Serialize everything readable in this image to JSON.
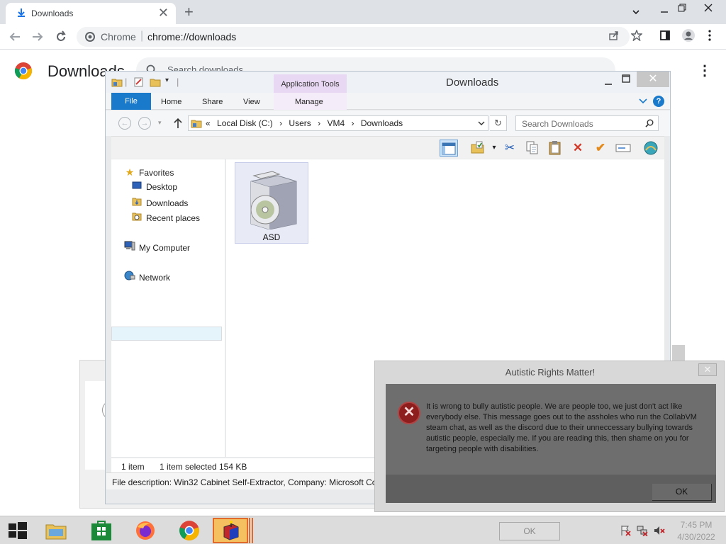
{
  "chrome": {
    "tab_title": "Downloads",
    "tab_close": "✕",
    "new_tab": "+",
    "site_label": "Chrome",
    "url": "chrome://downloads",
    "page_title": "Downloads",
    "search_placeholder": "Search downloads"
  },
  "explorer": {
    "title": "Downloads",
    "app_tools_label": "Application Tools",
    "ribbon_tabs": [
      "File",
      "Home",
      "Share",
      "View",
      "Manage"
    ],
    "breadcrumb": [
      "«",
      "Local Disk (C:)",
      "›",
      "Users",
      "›",
      "VM4",
      "›",
      "Downloads"
    ],
    "search_placeholder": "Search Downloads",
    "nav": {
      "favorites": "Favorites",
      "desktop": "Desktop",
      "downloads": "Downloads",
      "recent": "Recent places",
      "computer": "My Computer",
      "network": "Network"
    },
    "file_name": "ASD",
    "status": {
      "count": "1 item",
      "selected": "1 item selected",
      "size": "154 KB"
    },
    "description": "File description: Win32 Cabinet Self-Extractor, Company: Microsoft Co"
  },
  "dialog": {
    "title": "Autistic Rights Matter!",
    "message": "It is wrong to bully autistic people. We are people too, we just don't act like everybody else. This message goes out to the assholes who run the CollabVM steam chat, as well as the discord due to their unneccessary bullying towards autistic people, especially me. If you are reading this, then shame on you for targeting people with disabilities.",
    "ok_label": "OK"
  },
  "taskbar": {
    "ghost_ok_label": "OK",
    "time": "7:45 PM",
    "date": "4/30/2022",
    "apps": [
      "start-button",
      "file-explorer",
      "store",
      "firefox",
      "chrome",
      "setup-app"
    ]
  },
  "colors": {
    "chrome_tabbar": "#dee1e6",
    "explorer_file_tab": "#1979ca",
    "app_tools": "#e9d8f3",
    "dialog_body": "#6e6e6e",
    "taskbar_active": "#f4c060"
  }
}
